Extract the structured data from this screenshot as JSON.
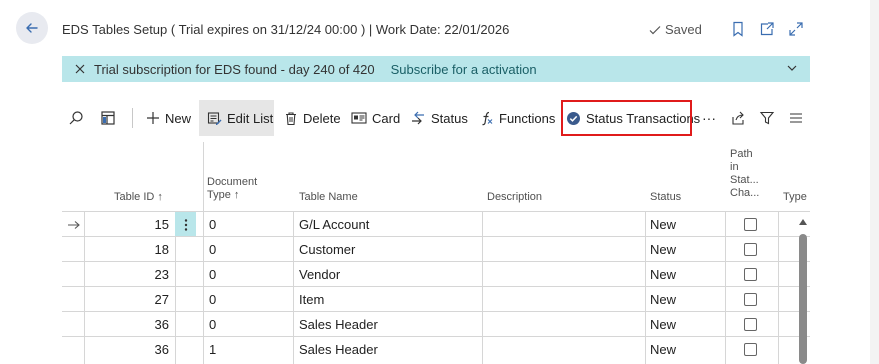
{
  "header": {
    "title": "EDS Tables Setup ( Trial expires on 31/12/24 00:00 ) | Work Date: 22/01/2026",
    "saved": "Saved"
  },
  "banner": {
    "message": "Trial subscription for EDS found - day 240 of 420",
    "link": "Subscribe for a activation"
  },
  "toolbar": {
    "new": "New",
    "edit_list": "Edit List",
    "delete": "Delete",
    "card": "Card",
    "status": "Status",
    "functions": "Functions",
    "status_transactions": "Status Transactions",
    "more": "···"
  },
  "grid": {
    "columns": {
      "table_id": "Table ID ↑",
      "document_type_1": "Document",
      "document_type_2": "Type ↑",
      "table_name": "Table Name",
      "description": "Description",
      "status": "Status",
      "path_1": "Path",
      "path_2": "in",
      "path_3": "Stat...",
      "path_4": "Cha...",
      "type": "Type"
    },
    "rows": [
      {
        "table_id": "15",
        "document_type": "0",
        "table_name": "G/L Account",
        "description": "",
        "status": "New",
        "path_in_status_change": false
      },
      {
        "table_id": "18",
        "document_type": "0",
        "table_name": "Customer",
        "description": "",
        "status": "New",
        "path_in_status_change": false
      },
      {
        "table_id": "23",
        "document_type": "0",
        "table_name": "Vendor",
        "description": "",
        "status": "New",
        "path_in_status_change": false
      },
      {
        "table_id": "27",
        "document_type": "0",
        "table_name": "Item",
        "description": "",
        "status": "New",
        "path_in_status_change": false
      },
      {
        "table_id": "36",
        "document_type": "0",
        "table_name": "Sales Header",
        "description": "",
        "status": "New",
        "path_in_status_change": false
      },
      {
        "table_id": "36",
        "document_type": "1",
        "table_name": "Sales Header",
        "description": "",
        "status": "New",
        "path_in_status_change": false
      }
    ]
  },
  "colors": {
    "banner_bg": "#b9e6ea",
    "highlight": "#e01b1b",
    "selected_cell": "#b9e6ea",
    "accent": "#1a5f66"
  }
}
